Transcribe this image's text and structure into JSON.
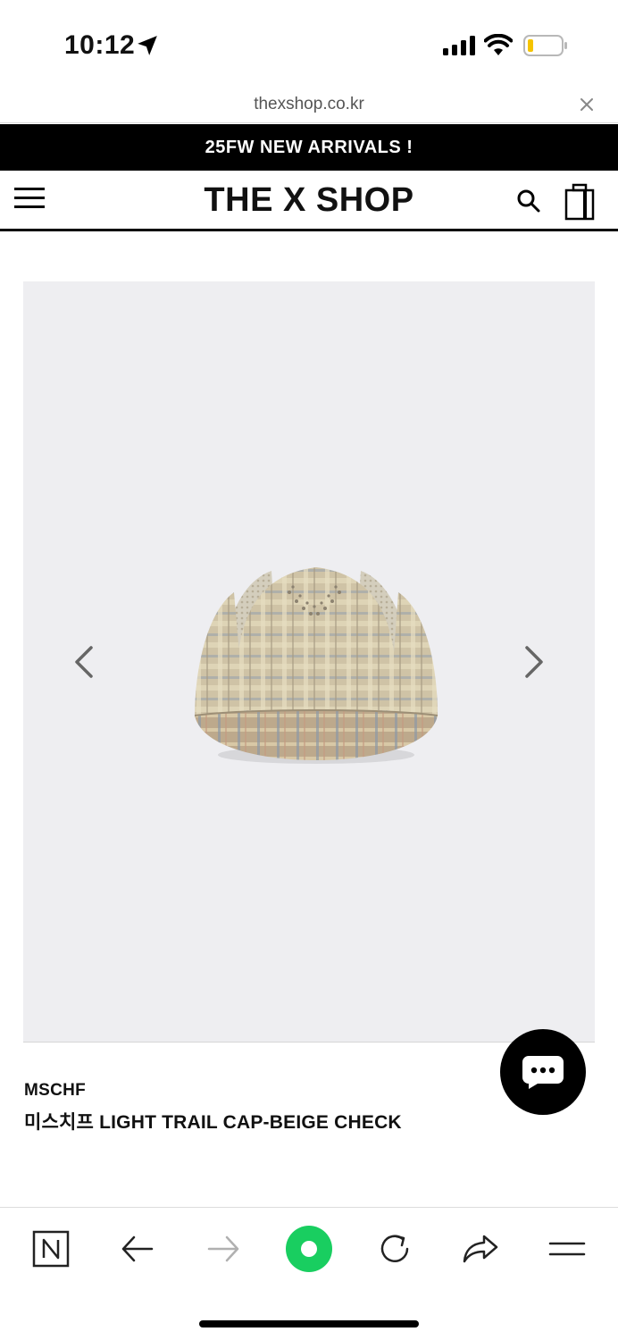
{
  "status_bar": {
    "time": "10:12",
    "icons": [
      "location-arrow-icon",
      "signal-icon",
      "wifi-icon",
      "battery-icon"
    ],
    "battery_color": "#f5c400"
  },
  "browser": {
    "url": "thexshop.co.kr",
    "close_icon": "close-icon"
  },
  "promo": {
    "text": "25FW NEW ARRIVALS !"
  },
  "header": {
    "logo": "THE X SHOP",
    "icons": [
      "hamburger-menu-icon",
      "search-icon",
      "shopping-bag-icon"
    ]
  },
  "product": {
    "brand": "MSCHF",
    "name": "미스치프 LIGHT TRAIL CAP-BEIGE CHECK",
    "gallery_bg": "#eeeef1",
    "image": "beige check cap photo"
  },
  "chat": {
    "icon": "chat-bubble-icon"
  },
  "toolbar": {
    "icons": [
      "naver-n-icon",
      "back-arrow-icon",
      "forward-arrow-icon",
      "green-dot-icon",
      "reload-icon",
      "share-icon",
      "menu-lines-icon"
    ],
    "accent": "#19ce60"
  }
}
